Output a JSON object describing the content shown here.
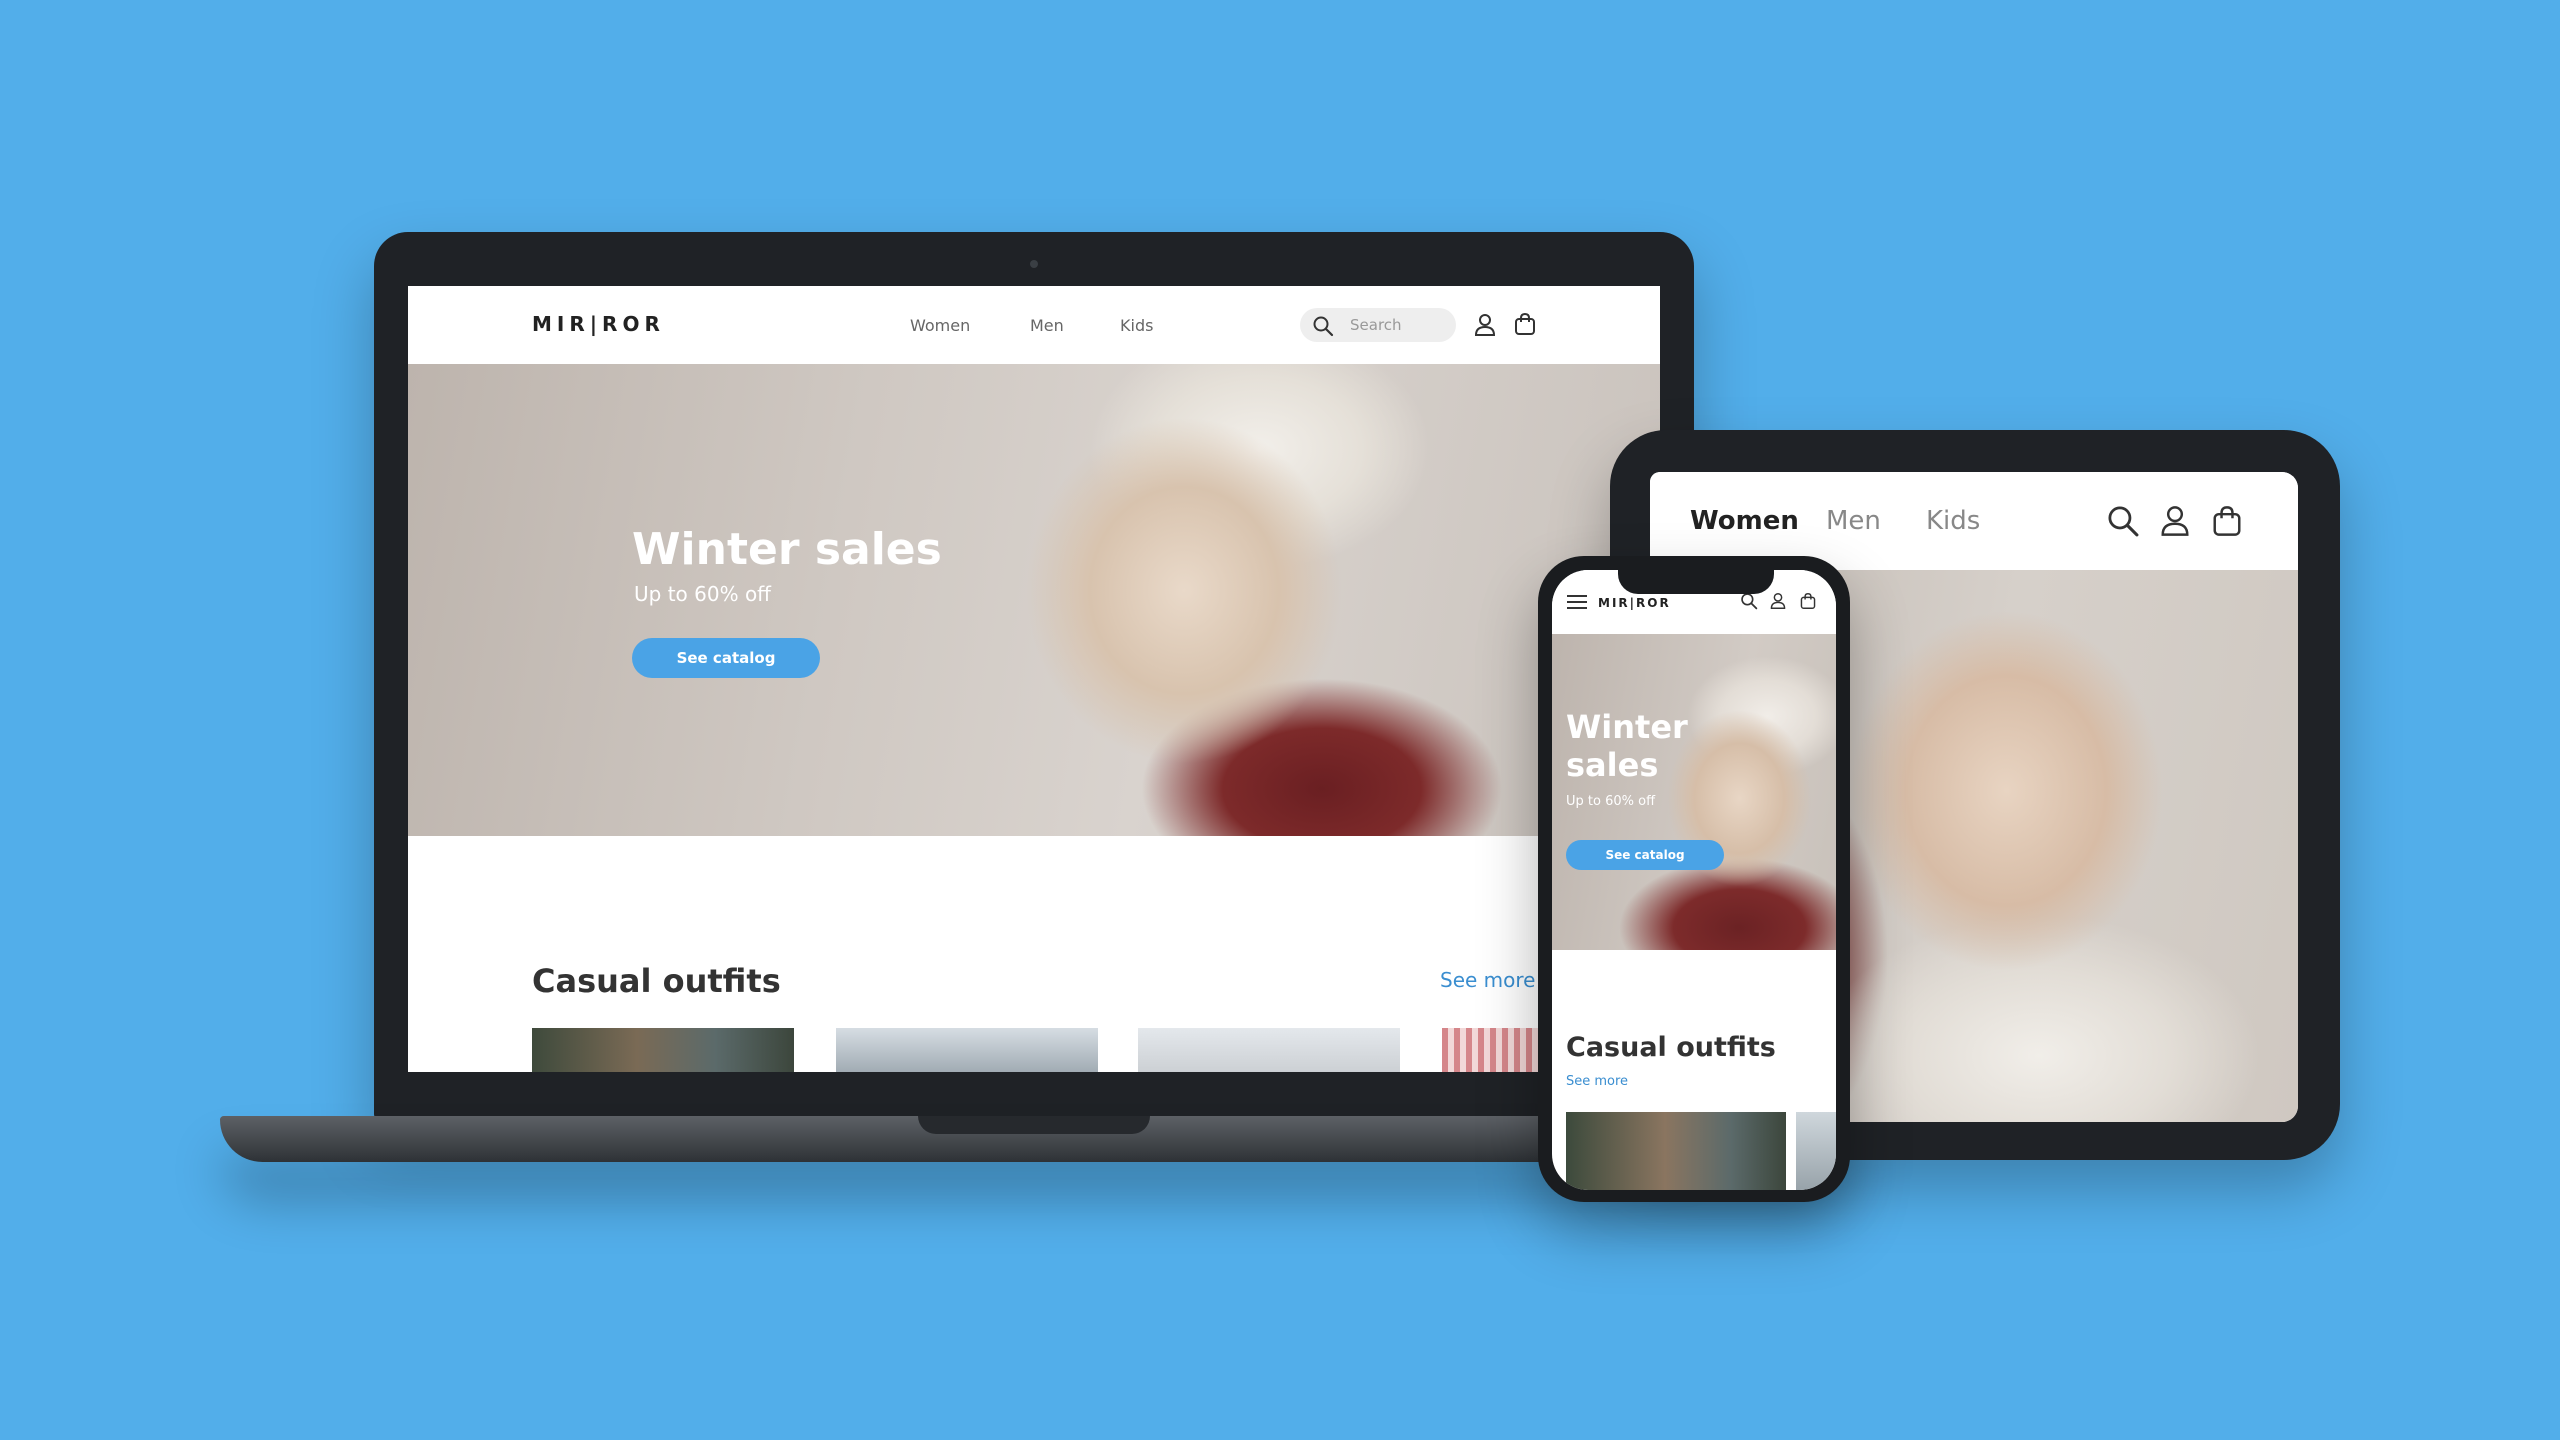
{
  "brand": {
    "logo": "MIR|ROR"
  },
  "laptop": {
    "nav": [
      "Women",
      "Men",
      "Kids"
    ],
    "search_placeholder": "Search",
    "hero": {
      "title": "Winter sales",
      "subtitle": "Up to 60% off",
      "cta": "See catalog"
    },
    "section": {
      "title": "Casual outfits",
      "see_more": "See more"
    }
  },
  "tablet": {
    "nav": [
      "Women",
      "Men",
      "Kids"
    ]
  },
  "phone": {
    "logo": "MIR|ROR",
    "hero": {
      "title_line1": "Winter",
      "title_line2": "sales",
      "subtitle": "Up to 60% off",
      "cta": "See catalog"
    },
    "section": {
      "title": "Casual outfits",
      "see_more": "See more"
    }
  },
  "colors": {
    "background": "#52aeea",
    "accent": "#4aa3e6",
    "link": "#3a8ed0",
    "device": "#1f2226"
  },
  "icons": [
    "search-icon",
    "user-icon",
    "shopping-bag-icon",
    "menu-icon"
  ]
}
